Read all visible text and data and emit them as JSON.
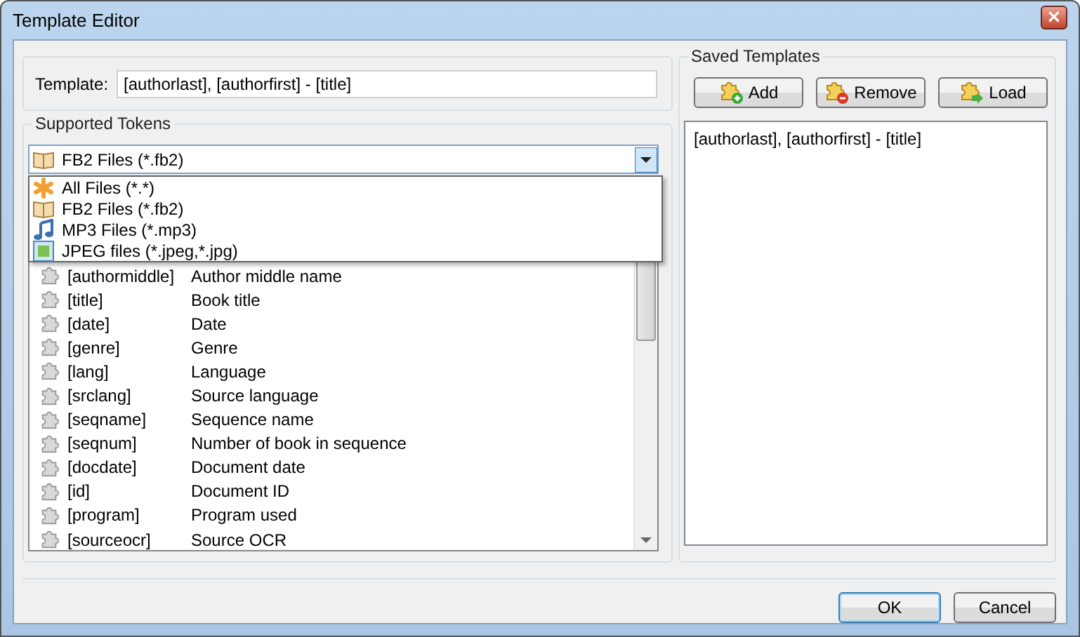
{
  "window": {
    "title": "Template Editor",
    "close": "×"
  },
  "template": {
    "label": "Template:",
    "value": "[authorlast], [authorfirst] - [title]"
  },
  "tokens": {
    "title": "Supported Tokens",
    "filter": {
      "kind": "book",
      "value": "FB2 Files (*.fb2)"
    },
    "options": [
      {
        "kind": "asterisk",
        "label": "All Files (*.*)"
      },
      {
        "kind": "book",
        "label": "FB2 Files (*.fb2)"
      },
      {
        "kind": "note",
        "label": "MP3 Files (*.mp3)"
      },
      {
        "kind": "image",
        "label": "JPEG files (*.jpeg,*.jpg)"
      }
    ],
    "rows": [
      {
        "token": "[authormiddle]",
        "description": "Author middle name"
      },
      {
        "token": "[title]",
        "description": "Book title"
      },
      {
        "token": "[date]",
        "description": "Date"
      },
      {
        "token": "[genre]",
        "description": "Genre"
      },
      {
        "token": "[lang]",
        "description": "Language"
      },
      {
        "token": "[srclang]",
        "description": "Source language"
      },
      {
        "token": "[seqname]",
        "description": "Sequence name"
      },
      {
        "token": "[seqnum]",
        "description": "Number of book in sequence"
      },
      {
        "token": "[docdate]",
        "description": "Document date"
      },
      {
        "token": "[id]",
        "description": "Document ID"
      },
      {
        "token": "[program]",
        "description": "Program used"
      },
      {
        "token": "[sourceocr]",
        "description": "Source OCR"
      }
    ]
  },
  "saved": {
    "title": "Saved Templates",
    "buttons": [
      {
        "label": "Add",
        "kind": "add"
      },
      {
        "label": "Remove",
        "kind": "remove"
      },
      {
        "label": "Load",
        "kind": "load"
      }
    ],
    "items": [
      "[authorlast], [authorfirst] - [title]"
    ]
  },
  "buttons": [
    {
      "label": "OK",
      "default": true
    },
    {
      "label": "Cancel",
      "default": false
    }
  ]
}
